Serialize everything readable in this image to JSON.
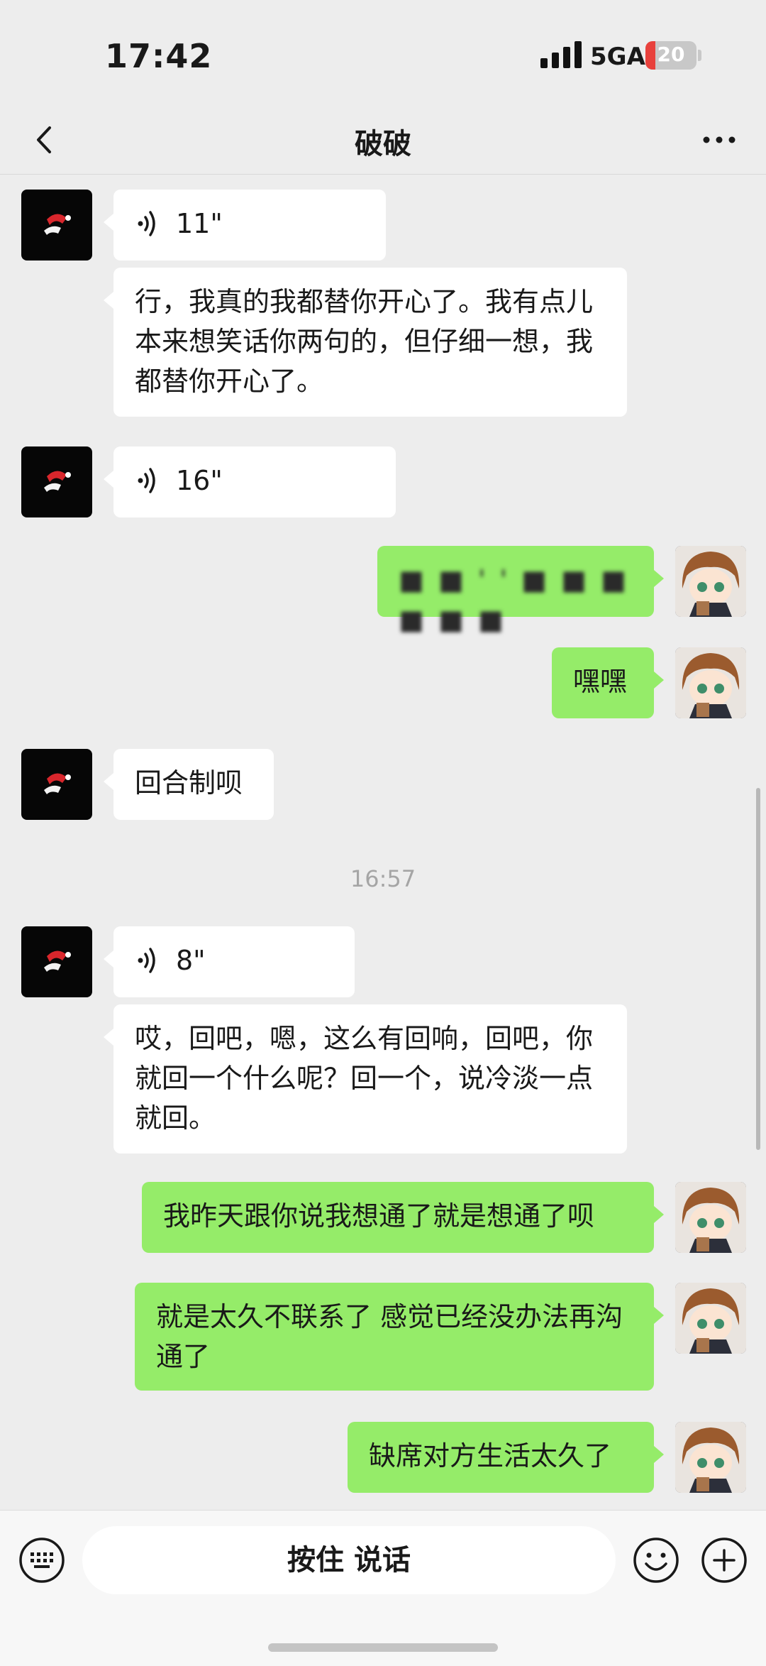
{
  "status_bar": {
    "time": "17:42",
    "network": "5GA",
    "battery": "20",
    "battery_level": 0.2
  },
  "header": {
    "title": "破破"
  },
  "messages": [
    {
      "sender": "friend",
      "type": "voice",
      "duration": "11\""
    },
    {
      "sender": "friend",
      "type": "text",
      "text": "行，我真的我都替你开心了。我有点儿本来想笑话你两句的，但仔细一想，我都替你开心了。"
    },
    {
      "sender": "friend",
      "type": "voice",
      "duration": "16\""
    },
    {
      "sender": "me",
      "type": "text",
      "text": "■ ■ ' ' ■ ■ ■ ■ ■ ■",
      "redacted": true
    },
    {
      "sender": "me",
      "type": "text",
      "text": "嘿嘿"
    },
    {
      "sender": "friend",
      "type": "text",
      "text": "回合制呗"
    },
    {
      "sender": "friend",
      "type": "voice",
      "duration": "8\""
    },
    {
      "sender": "friend",
      "type": "text",
      "text": "哎，回吧，嗯，这么有回响，回吧，你就回一个什么呢？回一个，说冷淡一点就回。"
    },
    {
      "sender": "me",
      "type": "text",
      "text": "我昨天跟你说我想通了就是想通了呗"
    },
    {
      "sender": "me",
      "type": "text",
      "text": "就是太久不联系了 感觉已经没办法再沟通了"
    },
    {
      "sender": "me",
      "type": "text",
      "text": "缺席对方生活太久了"
    }
  ],
  "timestamps": [
    "16:57"
  ],
  "input_bar": {
    "talk_label": "按住 说话"
  },
  "colors": {
    "background": "#ededed",
    "bubble_out": "#95ec69",
    "bubble_in": "#ffffff",
    "battery_low": "#e8413c"
  },
  "icons": {
    "back": "chevron-left-icon",
    "more": "more-icon",
    "keyboard": "keyboard-icon",
    "emoji": "emoji-icon",
    "plus": "plus-icon",
    "voice": "voice-wave-icon"
  }
}
